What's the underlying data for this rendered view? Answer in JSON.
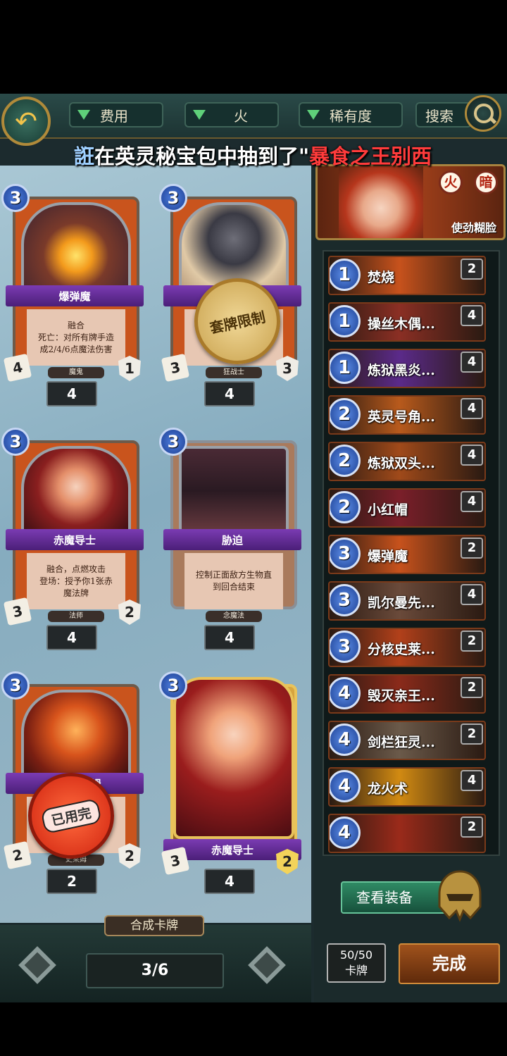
{
  "toolbar": {
    "filters": [
      {
        "label": "费用"
      },
      {
        "label": "火"
      },
      {
        "label": "稀有度"
      }
    ],
    "search_label": "搜索"
  },
  "marquee": {
    "player": "誑",
    "message": "在英灵秘宝包中抽到了\"",
    "item": "暴食之王别西"
  },
  "cards": [
    {
      "name": "爆弹魔",
      "cost": "3",
      "text": [
        "融合",
        "死亡：对所有牌手造",
        "成2/4/6点魔法伤害"
      ],
      "race": "魔鬼",
      "attack": "4",
      "health": "1",
      "count": "4",
      "stamp": ""
    },
    {
      "name": "凯尔曼先锋",
      "cost": "3",
      "text": [],
      "race": "狂战士",
      "attack": "3",
      "health": "3",
      "count": "4",
      "stamp": "套牌限制"
    },
    {
      "name": "赤魔导士",
      "cost": "3",
      "text": [
        "融合，点燃攻击",
        "登场：授予你1张赤",
        "魔法牌"
      ],
      "race": "法师",
      "attack": "3",
      "health": "2",
      "count": "4",
      "stamp": ""
    },
    {
      "name": "胁迫",
      "cost": "3",
      "text": [
        "控制正面敌方生物直",
        "到回合结束"
      ],
      "race": "念魔法",
      "attack": "",
      "health": "",
      "count": "4",
      "stamp": ""
    },
    {
      "name": "分核史莱姆",
      "cost": "3",
      "text": [],
      "race": "史莱姆",
      "attack": "2",
      "health": "2",
      "count": "2",
      "stamp": "已用完"
    },
    {
      "name": "赤魔导士",
      "cost": "3",
      "text": [],
      "race": "",
      "attack": "3",
      "health": "2",
      "count": "4",
      "stamp": ""
    }
  ],
  "bottom": {
    "craft_label": "合成卡牌",
    "page": "3/6"
  },
  "hero": {
    "elements": [
      "火",
      "暗"
    ],
    "skill": "使劲糊脸"
  },
  "deck": [
    {
      "cost": "1",
      "name": "焚烧",
      "count": "2",
      "color": "#c7521c"
    },
    {
      "cost": "1",
      "name": "操丝木偶...",
      "count": "4",
      "color": "#8b2f24"
    },
    {
      "cost": "1",
      "name": "炼狱黑炎...",
      "count": "4",
      "color": "#5b2a8a"
    },
    {
      "cost": "2",
      "name": "英灵号角...",
      "count": "4",
      "color": "#b85a1c"
    },
    {
      "cost": "2",
      "name": "炼狱双头...",
      "count": "4",
      "color": "#a04a1a"
    },
    {
      "cost": "2",
      "name": "小红帽",
      "count": "4",
      "color": "#7b1f2a"
    },
    {
      "cost": "3",
      "name": "爆弹魔",
      "count": "2",
      "color": "#c7521c"
    },
    {
      "cost": "3",
      "name": "凯尔曼先...",
      "count": "4",
      "color": "#6a4a3a"
    },
    {
      "cost": "3",
      "name": "分核史莱...",
      "count": "2",
      "color": "#b2401a"
    },
    {
      "cost": "4",
      "name": "毁灭亲王...",
      "count": "2",
      "color": "#8a2a1a"
    },
    {
      "cost": "4",
      "name": "剑栏狂灵...",
      "count": "2",
      "color": "#6b5a4a"
    },
    {
      "cost": "4",
      "name": "龙火术",
      "count": "4",
      "color": "#d18a12"
    },
    {
      "cost": "4",
      "name": "",
      "count": "2",
      "color": "#9a2a1a"
    }
  ],
  "equip_label": "查看装备",
  "card_count": {
    "value": "50/50",
    "label": "卡牌"
  },
  "done_label": "完成"
}
